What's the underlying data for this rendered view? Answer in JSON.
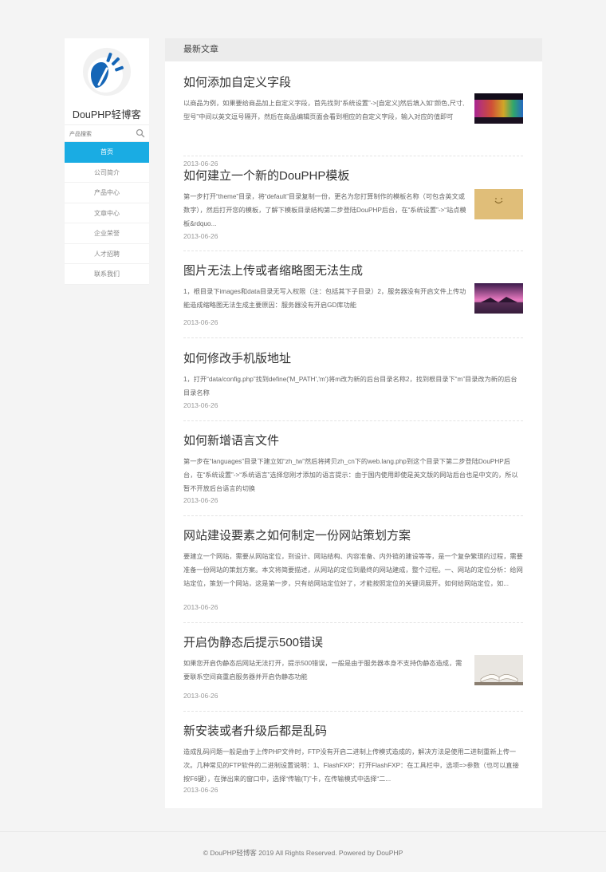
{
  "sidebar": {
    "site_name": "DouPHP轻博客",
    "search_placeholder": "产品搜索",
    "nav": [
      "首页",
      "公司简介",
      "产品中心",
      "文章中心",
      "企业荣誉",
      "人才招聘",
      "联系我们"
    ]
  },
  "main": {
    "section_title": "最新文章",
    "articles": [
      {
        "title": "如何添加自定义字段",
        "desc": "以商品为例，如果要给商品加上自定义字段，首先找到“系统设置”->[自定义]然后填入如“颜色,尺寸,型号”中间以英文逗号隔开，然后在商品编辑页面会看到相应的自定义字段，输入对应的值即可",
        "date": "2013-06-26",
        "thumb": "rainbow-lights"
      },
      {
        "title": "如何建立一个新的DouPHP模板",
        "desc": "第一步打开“theme”目录，将“default”目录复制一份，更名为您打算制作的模板名称（可包含英文或数字），然后打开您的模板，了解下模板目录结构第二步登陆DouPHP后台，在“系统设置”->“站点模板&rdquo...",
        "date": "2013-06-26",
        "thumb": "gold-smile"
      },
      {
        "title": "图片无法上传或者缩略图无法生成",
        "desc": "1，根目录下images和data目录无写入权限（注：包括其下子目录）2，服务器没有开启文件上传功能造成缩略图无法生成主要原因：服务器没有开启GD库功能",
        "date": "2013-06-26",
        "thumb": "sunset-pier"
      },
      {
        "title": "如何修改手机版地址",
        "desc": "1，打开“data/config.php”找到define('M_PATH','m')将m改为新的后台目录名称2，找到根目录下“m”目录改为新的后台目录名称",
        "date": "2013-06-26",
        "thumb": ""
      },
      {
        "title": "如何新增语言文件",
        "desc": "第一步在“languages”目录下建立如“zh_tw”然后将拷贝zh_cn下的web.lang.php到这个目录下第二步登陆DouPHP后台，在“系统设置”->“系统语言”选择您刚才添加的语言提示：由于国内使用即使是英文版的网站后台也是中文的，所以暂不开放后台语言的切换",
        "date": "2013-06-26",
        "thumb": ""
      },
      {
        "title": "网站建设要素之如何制定一份网站策划方案",
        "desc": "要建立一个网站，需要从网站定位，到设计、网站结构、内容准备、内外链的建设等等，是一个复杂繁琐的过程，需要准备一份网站的策划方案。本文将简要描述，从网站的定位到最终的网站建成，整个过程。一、网站的定位分析：给网站定位，策划一个网站，这是第一步，只有给网站定位好了，才能按照定位的关键词展开。如何给网站定位，如...",
        "date": "2013-06-26",
        "thumb": ""
      },
      {
        "title": "开启伪静态后提示500错误",
        "desc": "如果您开启伪静态后网站无法打开，提示500错误，一般是由于服务器本身不支持伪静态造成，需要联系空间商重启服务器并开启伪静态功能",
        "date": "2013-06-26",
        "thumb": "open-book"
      },
      {
        "title": "新安装或者升级后都是乱码",
        "desc": "造成乱码问题一般是由于上传PHP文件时，FTP没有开启二进制上传模式造成的，解决方法是使用二进制重新上传一次。几种常见的FTP软件的二进制设置说明：1、FlashFXP：打开FlashFXP：在工具栏中，选项=>参数（也可以直接按F6键），在弹出来的窗口中，选择“传输(T)”卡，在传输模式中选择“二...",
        "date": "2013-06-26",
        "thumb": ""
      }
    ]
  },
  "footer": {
    "text": "© DouPHP轻博客 2019 All Rights Reserved. Powered by DouPHP"
  },
  "colors": {
    "accent": "#1aace3",
    "background": "#f4f4f4"
  }
}
